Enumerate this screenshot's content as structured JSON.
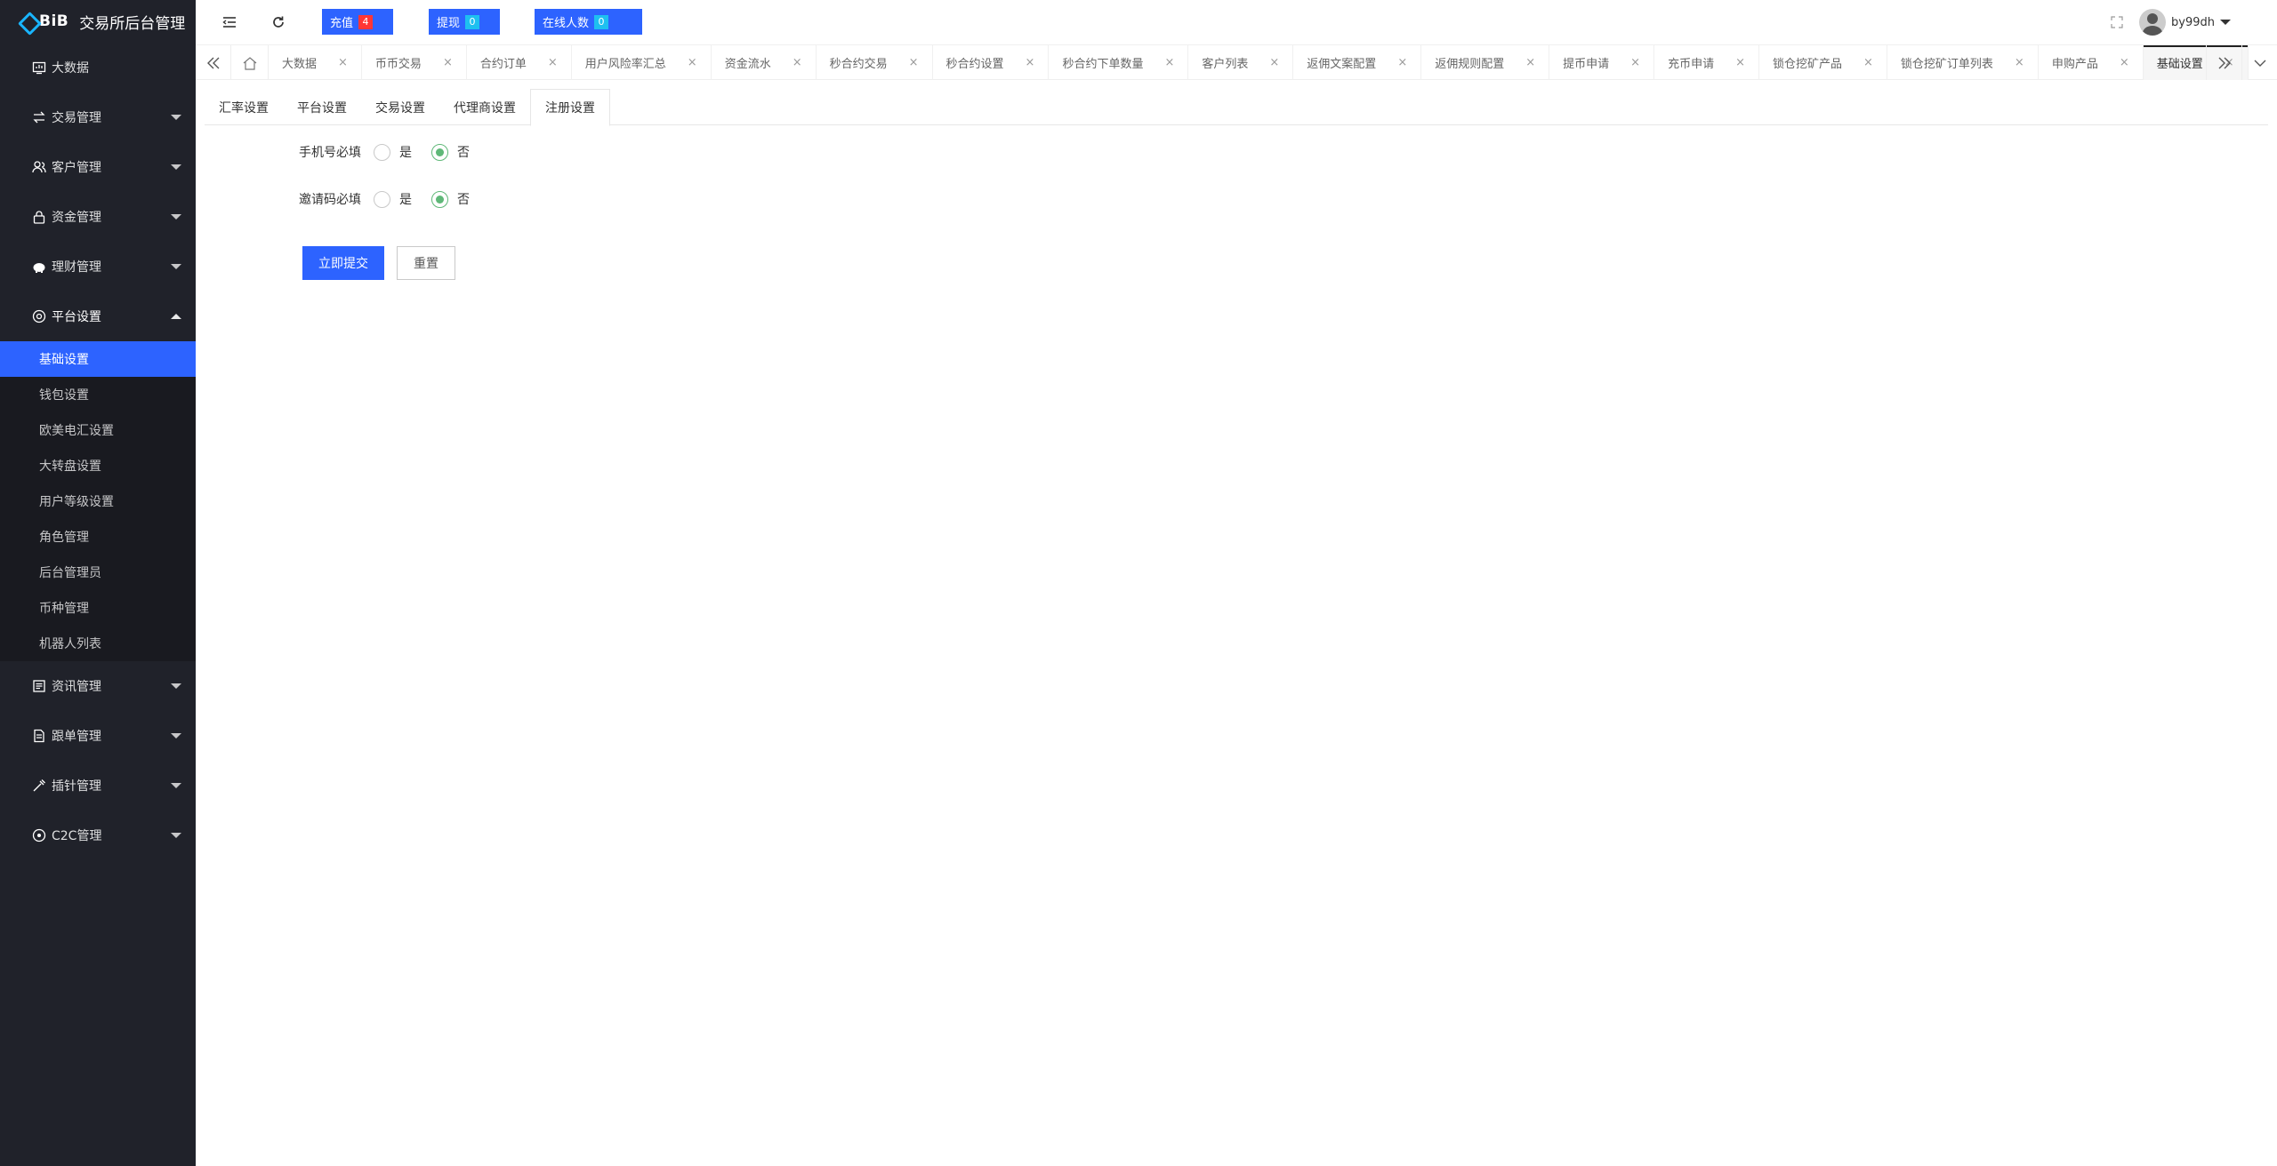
{
  "app": {
    "brand": "BiB",
    "title": "交易所后台管理"
  },
  "sidebar": {
    "items": [
      {
        "label": "大数据",
        "icon": "dashboard-icon",
        "has_arrow": false
      },
      {
        "label": "交易管理",
        "icon": "swap-icon",
        "has_arrow": true
      },
      {
        "label": "客户管理",
        "icon": "users-icon",
        "has_arrow": true
      },
      {
        "label": "资金管理",
        "icon": "lock-icon",
        "has_arrow": true
      },
      {
        "label": "理财管理",
        "icon": "piggy-bank-icon",
        "has_arrow": true
      },
      {
        "label": "平台设置",
        "icon": "settings-icon",
        "has_arrow": true,
        "open": true
      },
      {
        "label": "资讯管理",
        "icon": "news-icon",
        "has_arrow": true
      },
      {
        "label": "跟单管理",
        "icon": "document-icon",
        "has_arrow": true
      },
      {
        "label": "插针管理",
        "icon": "needle-icon",
        "has_arrow": true
      },
      {
        "label": "C2C管理",
        "icon": "circle-icon",
        "has_arrow": true
      }
    ],
    "platform_sub": [
      "基础设置",
      "钱包设置",
      "欧美电汇设置",
      "大转盘设置",
      "用户等级设置",
      "角色管理",
      "后台管理员",
      "币种管理",
      "机器人列表"
    ],
    "active_sub": "基础设置"
  },
  "header": {
    "recharge": {
      "label": "充值",
      "count": "4"
    },
    "withdraw": {
      "label": "提现",
      "count": "0"
    },
    "online": {
      "label": "在线人数",
      "count": "0"
    },
    "username": "by99dh"
  },
  "page_tabs": [
    "大数据",
    "币币交易",
    "合约订单",
    "用户风险率汇总",
    "资金流水",
    "秒合约交易",
    "秒合约设置",
    "秒合约下单数量",
    "客户列表",
    "返佣文案配置",
    "返佣规则配置",
    "提币申请",
    "充币申请",
    "锁仓挖矿产品",
    "锁仓挖矿订单列表",
    "申购产品",
    "基础设置"
  ],
  "active_page_tab": "基础设置",
  "sub_tabs": [
    "汇率设置",
    "平台设置",
    "交易设置",
    "代理商设置",
    "注册设置"
  ],
  "active_sub_tab": "注册设置",
  "form": {
    "phone": {
      "label": "手机号必填",
      "yes": "是",
      "no": "否",
      "value": "否"
    },
    "invite": {
      "label": "邀请码必填",
      "yes": "是",
      "no": "否",
      "value": "否"
    },
    "submit": "立即提交",
    "reset": "重置"
  },
  "colors": {
    "sidebar_bg": "#20222a",
    "accent": "#2d63ff",
    "radio_on": "#5fb878",
    "badge_red": "#ff3636",
    "badge_cyan": "#1ec0f0"
  }
}
